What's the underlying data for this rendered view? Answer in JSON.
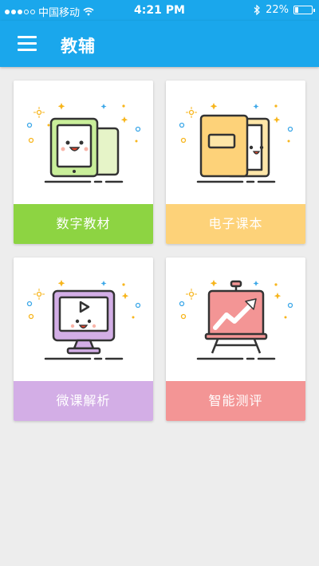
{
  "status_bar": {
    "carrier": "中国移动",
    "time": "4:21 PM",
    "battery_percent": "22%",
    "battery_level": 0.22,
    "signal_icon": "signal-dots-icon",
    "wifi_icon": "wifi-icon",
    "bluetooth_icon": "bluetooth-icon"
  },
  "nav": {
    "title": "教辅",
    "menu_icon": "hamburger-menu-icon",
    "background_color": "#1aa7ec"
  },
  "cards": [
    {
      "label": "数字教材",
      "color": "#8dd442",
      "icon": "tablet-book-icon"
    },
    {
      "label": "电子课本",
      "color": "#fdd279",
      "icon": "folder-book-icon"
    },
    {
      "label": "微课解析",
      "color": "#d3aee6",
      "icon": "monitor-video-icon"
    },
    {
      "label": "智能测评",
      "color": "#f39595",
      "icon": "chart-board-icon"
    }
  ]
}
